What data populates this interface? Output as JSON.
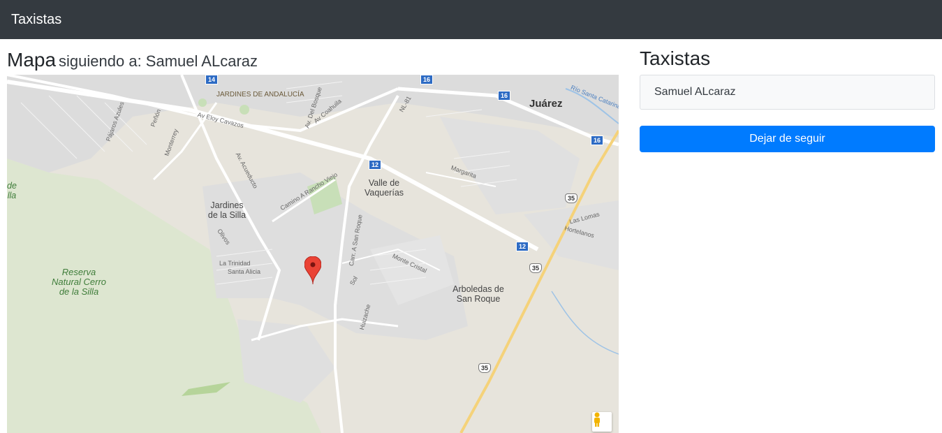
{
  "navbar": {
    "brand": "Taxistas"
  },
  "header": {
    "title": "Mapa",
    "subtitle": "siguiendo a: Samuel ALcaraz"
  },
  "map": {
    "labels": {
      "jardines_andalucia": "JARDINES DE ANDALUCÍA",
      "juarez": "Juárez",
      "av_eloy_cavazos": "Av Eloy Cavazos",
      "av_del_bosque": "Av. Del Bosque",
      "av_coahuila": "Av Coahuila",
      "nl81": "NL-81",
      "rio_santa_catarina": "Río Santa Catarina",
      "pajaros_azules": "Pájaros Azules",
      "penon": "Peñón",
      "monterrey": "Monterrey",
      "av_acueducto": "Av. Acueducto",
      "margarita": "Margarita",
      "valle_vaquerias": "Valle de Vaquerías",
      "camino_rancho_viejo": "Camino A Rancho Viejo",
      "jardines_silla": "Jardines de la Silla",
      "olivos": "Olivos",
      "la_trinidad": "La Trinidad",
      "santa_alicia": "Santa Alicia",
      "reserva": "Reserva Natural Cerro de la Silla",
      "carr_san_roque": "Carr. A San Roque",
      "monte_cristal": "Monte Cristal",
      "sol": "Sol",
      "huizache": "Huizache",
      "arboledas": "Arboledas de San Roque",
      "las_lomas": "Las Lomas",
      "hortelanos": "Hortelanos",
      "de_lla": "de lla"
    },
    "shields": {
      "s14": "14",
      "s16a": "16",
      "s16b": "16",
      "s16c": "16",
      "s12a": "12",
      "s12b": "12",
      "s35a": "35",
      "s35b": "35",
      "s35c": "35"
    },
    "colors": {
      "land": "#e7e4dc",
      "urban": "#dcdcdc",
      "road": "#ffffff",
      "highway": "#f5d27a",
      "park": "#c8dfb8",
      "marker": "#ea4335"
    }
  },
  "sidebar": {
    "title": "Taxistas",
    "drivers": [
      {
        "name": "Samuel ALcaraz"
      }
    ],
    "unfollow_button": "Dejar de seguir"
  }
}
